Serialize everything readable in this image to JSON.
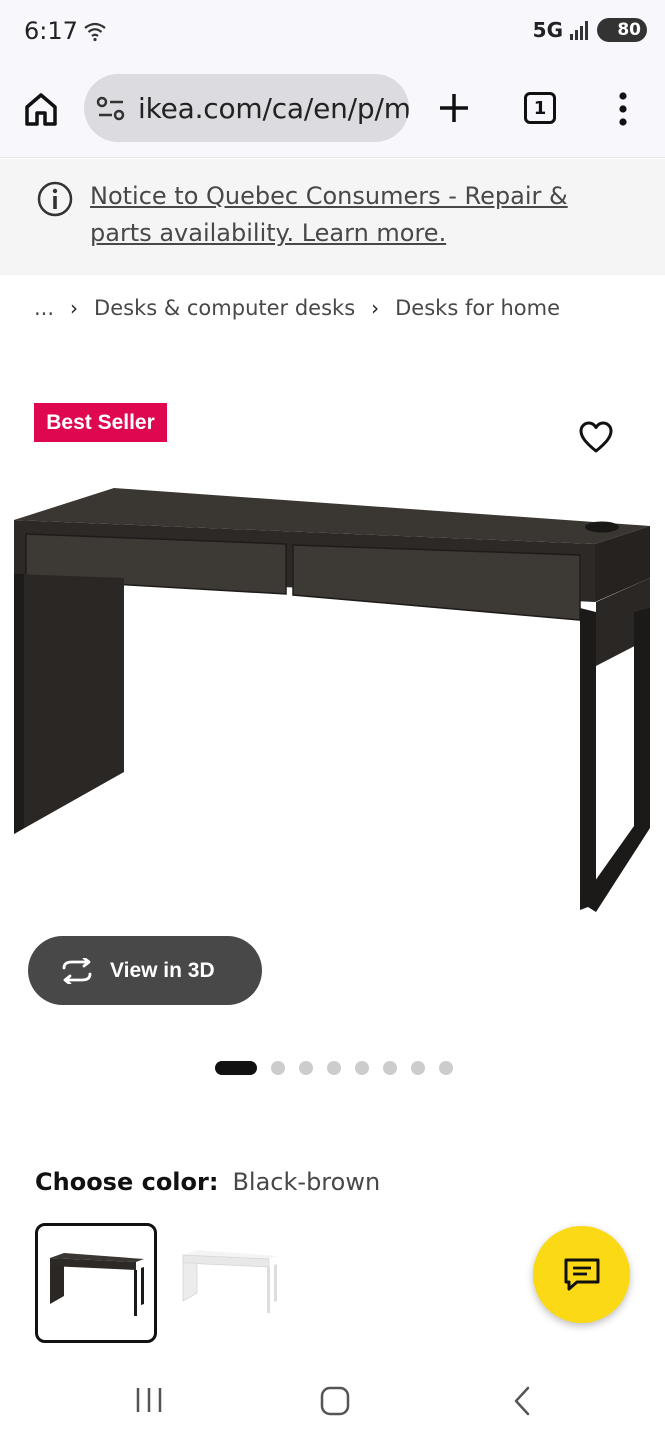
{
  "status_bar": {
    "time": "6:17",
    "network": "5G",
    "battery": "80"
  },
  "browser": {
    "url": "ikea.com/ca/en/p/mic",
    "tab_count": "1"
  },
  "notice": {
    "text": "Notice to Quebec Consumers - Repair & parts availability. Learn more."
  },
  "breadcrumb": {
    "items": [
      "...",
      "Desks & computer desks",
      "Desks for home"
    ]
  },
  "product": {
    "badge": "Best Seller",
    "view_3d_label": "View in 3D",
    "carousel": {
      "total_images": 8,
      "active_index": 0
    },
    "color_label": "Choose color:",
    "color_value": "Black-brown",
    "swatches": [
      {
        "name": "Black-brown",
        "selected": true,
        "color": "#3b3631"
      },
      {
        "name": "White",
        "selected": false,
        "color": "#f2f2f2"
      }
    ]
  },
  "colors": {
    "badge": "#e00751",
    "chat_fab": "#fbd914",
    "view3d_bg": "#484848",
    "desk": "#3b3631"
  },
  "icons": [
    "home-icon",
    "site-settings-icon",
    "plus-icon",
    "tabs-icon",
    "more-vert-icon",
    "info-icon",
    "heart-icon",
    "rotate-3d-icon",
    "chat-icon"
  ]
}
